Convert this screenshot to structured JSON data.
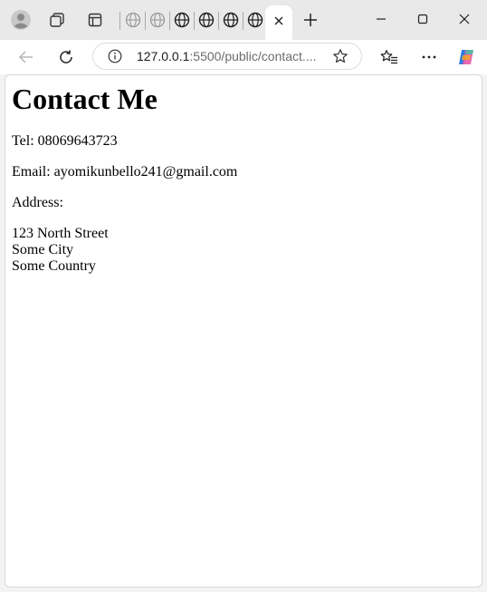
{
  "browser": {
    "url_host": "127.0.0.1",
    "url_rest": ":5500/public/contact...."
  },
  "page": {
    "heading": "Contact Me",
    "tel": "Tel: 08069643723",
    "email": "Email: ayomikunbello241@gmail.com",
    "address_label": "Address:",
    "address_lines": [
      "123 North Street",
      "Some City",
      "Some Country"
    ]
  }
}
